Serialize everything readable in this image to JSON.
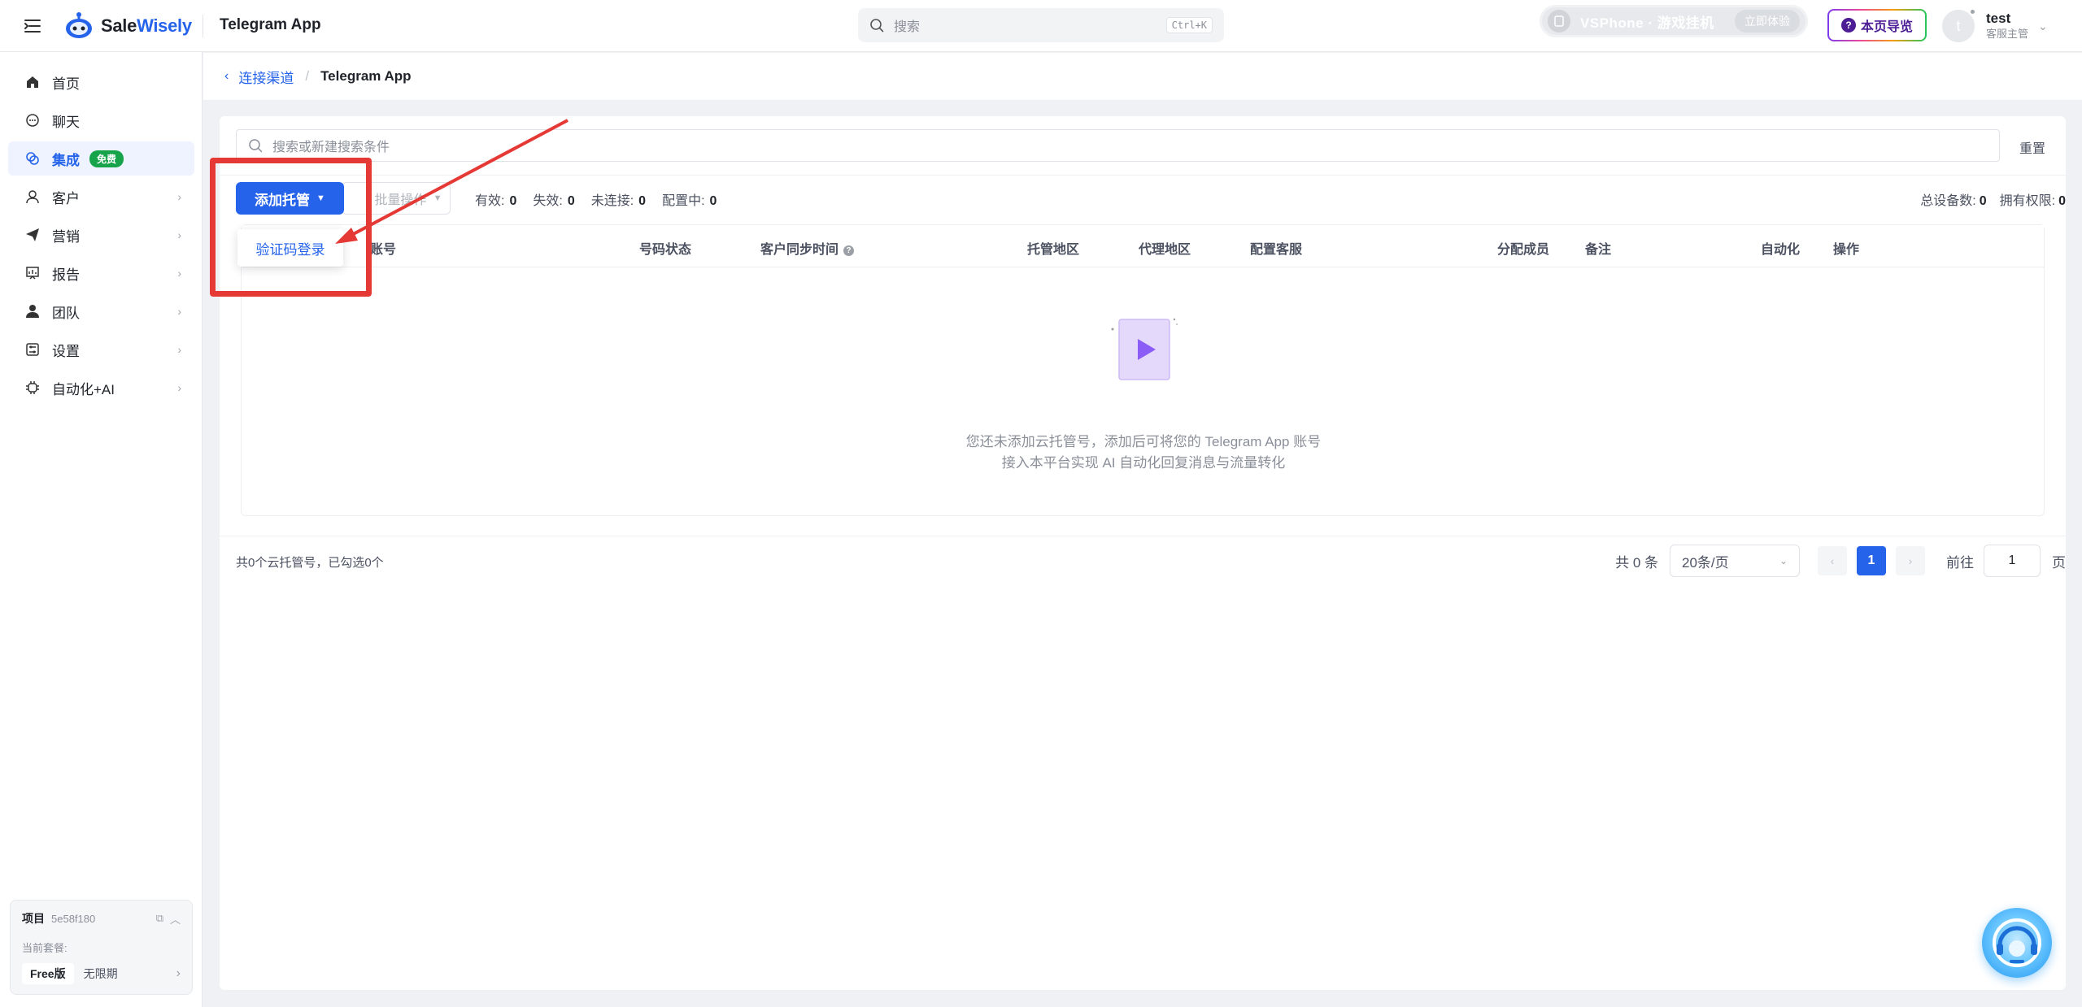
{
  "header": {
    "brand_prefix": "Sale",
    "brand_suffix": "Wisely",
    "app_title": "Telegram App",
    "search_placeholder": "搜索",
    "search_shortcut": "Ctrl+K",
    "promo_text": "VSPhone · 游戏挂机",
    "promo_button": "立即体验",
    "guide_label": "本页导览",
    "user_initial": "t",
    "user_name": "test",
    "user_role": "客服主管"
  },
  "sidebar": {
    "items": [
      {
        "label": "首页",
        "icon": "home-icon"
      },
      {
        "label": "聊天",
        "icon": "chat-icon"
      },
      {
        "label": "集成",
        "icon": "integration-icon",
        "badge": "免费",
        "active": true
      },
      {
        "label": "客户",
        "icon": "user-icon"
      },
      {
        "label": "营销",
        "icon": "send-icon"
      },
      {
        "label": "报告",
        "icon": "report-icon"
      },
      {
        "label": "团队",
        "icon": "team-icon"
      },
      {
        "label": "设置",
        "icon": "settings-icon"
      },
      {
        "label": "自动化+AI",
        "icon": "chip-icon"
      }
    ],
    "project": {
      "label": "项目",
      "id": "5e58f180",
      "plan_label": "当前套餐:",
      "plan": "Free版",
      "term": "无限期"
    }
  },
  "breadcrumb": {
    "parent": "连接渠道",
    "current": "Telegram App"
  },
  "filter": {
    "placeholder": "搜索或新建搜索条件",
    "reset_label": "重置"
  },
  "toolbar": {
    "add_label": "添加托管",
    "batch_label": "批量操作",
    "stats": [
      {
        "label": "有效:",
        "value": "0"
      },
      {
        "label": "失效:",
        "value": "0"
      },
      {
        "label": "未连接:",
        "value": "0"
      },
      {
        "label": "配置中:",
        "value": "0"
      }
    ],
    "stats_right": [
      {
        "label": "总设备数:",
        "value": "0"
      },
      {
        "label": "拥有权限:",
        "value": "0"
      }
    ]
  },
  "dropdown": {
    "item": "验证码登录"
  },
  "table": {
    "columns": [
      "账号",
      "号码状态",
      "客户同步时间",
      "托管地区",
      "代理地区",
      "配置客服",
      "分配成员",
      "备注",
      "自动化",
      "操作"
    ],
    "empty_line1": "您还未添加云托管号，添加后可将您的 Telegram App 账号",
    "empty_line2": "接入本平台实现 AI 自动化回复消息与流量转化"
  },
  "footer": {
    "summary": "共0个云托管号，已勾选0个",
    "total": "共 0 条",
    "page_size": "20条/页",
    "current_page": "1",
    "goto_label": "前往",
    "goto_value": "1",
    "page_suffix": "页"
  },
  "colors": {
    "accent": "#2563eb",
    "annotation": "#e53935",
    "badge": "#16a34a"
  }
}
